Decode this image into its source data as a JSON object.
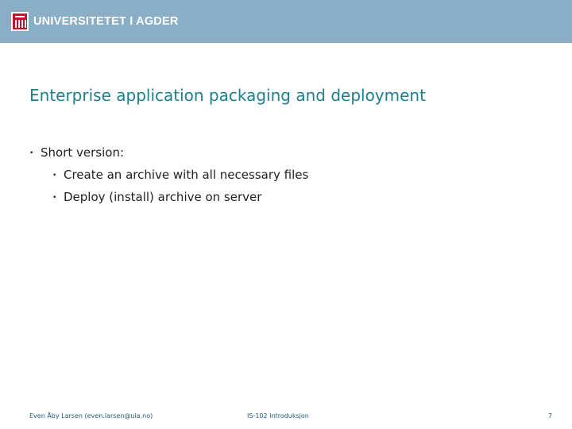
{
  "header": {
    "logo_text": "UNIVERSITETET I AGDER",
    "band_color": "#8aaec6",
    "logo_color": "#c8102e"
  },
  "slide": {
    "title": "Enterprise application packaging and deployment",
    "bullets": [
      {
        "level": 1,
        "text": "Short version:"
      },
      {
        "level": 2,
        "text": "Create an archive with all necessary files"
      },
      {
        "level": 2,
        "text": "Deploy (install) archive on server"
      }
    ],
    "title_color": "#1e7f8c"
  },
  "footer": {
    "author": "Even Åby Larsen (even.larsen@uia.no)",
    "course": "IS-102 Introduksjon",
    "page_number": "7"
  }
}
